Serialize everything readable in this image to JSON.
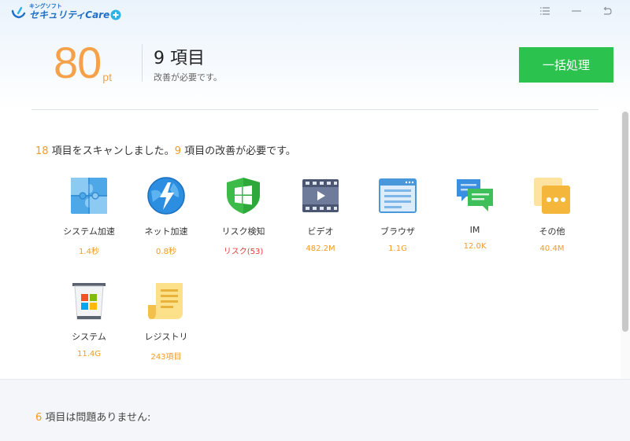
{
  "app": {
    "logo_small": "キングソフト",
    "logo_big": "セキュリティCare"
  },
  "window_controls": [
    "menu-icon",
    "minimize-icon",
    "restore-icon"
  ],
  "summary": {
    "score": "80",
    "score_unit": "pt",
    "items_count": "9 項目",
    "items_sub": "改善が必要です。",
    "fix_all_label": "一括処理"
  },
  "scan_message": {
    "scanned_count": "18",
    "part1": " 項目をスキャンしました。",
    "need_count": "9",
    "part2": " 項目の改善が必要です。"
  },
  "items": [
    {
      "label": "システム加速",
      "value": "1.4秒",
      "icon": "puzzle-icon"
    },
    {
      "label": "ネット加速",
      "value": "0.8秒",
      "icon": "lightning-globe-icon"
    },
    {
      "label": "リスク検知",
      "value": "リスク(53)",
      "icon": "shield-windows-icon",
      "alert": true
    },
    {
      "label": "ビデオ",
      "value": "482.2M",
      "icon": "film-icon"
    },
    {
      "label": "ブラウザ",
      "value": "1.1G",
      "icon": "browser-window-icon"
    },
    {
      "label": "IM",
      "value": "12.0K",
      "icon": "chat-bubbles-icon"
    },
    {
      "label": "その他",
      "value": "40.4M",
      "icon": "more-dots-icon"
    },
    {
      "label": "システム",
      "value": "11.4G",
      "icon": "windows-trash-icon"
    },
    {
      "label": "レジストリ",
      "value": "243項目",
      "icon": "registry-scroll-icon"
    }
  ],
  "ok_message": {
    "count": "6",
    "text": " 項目は問題ありません:"
  },
  "colors": {
    "accent_orange": "#f59a23",
    "fix_green": "#2bc24d",
    "alert_red": "#e0403a",
    "brand_blue": "#1d6fc7"
  }
}
